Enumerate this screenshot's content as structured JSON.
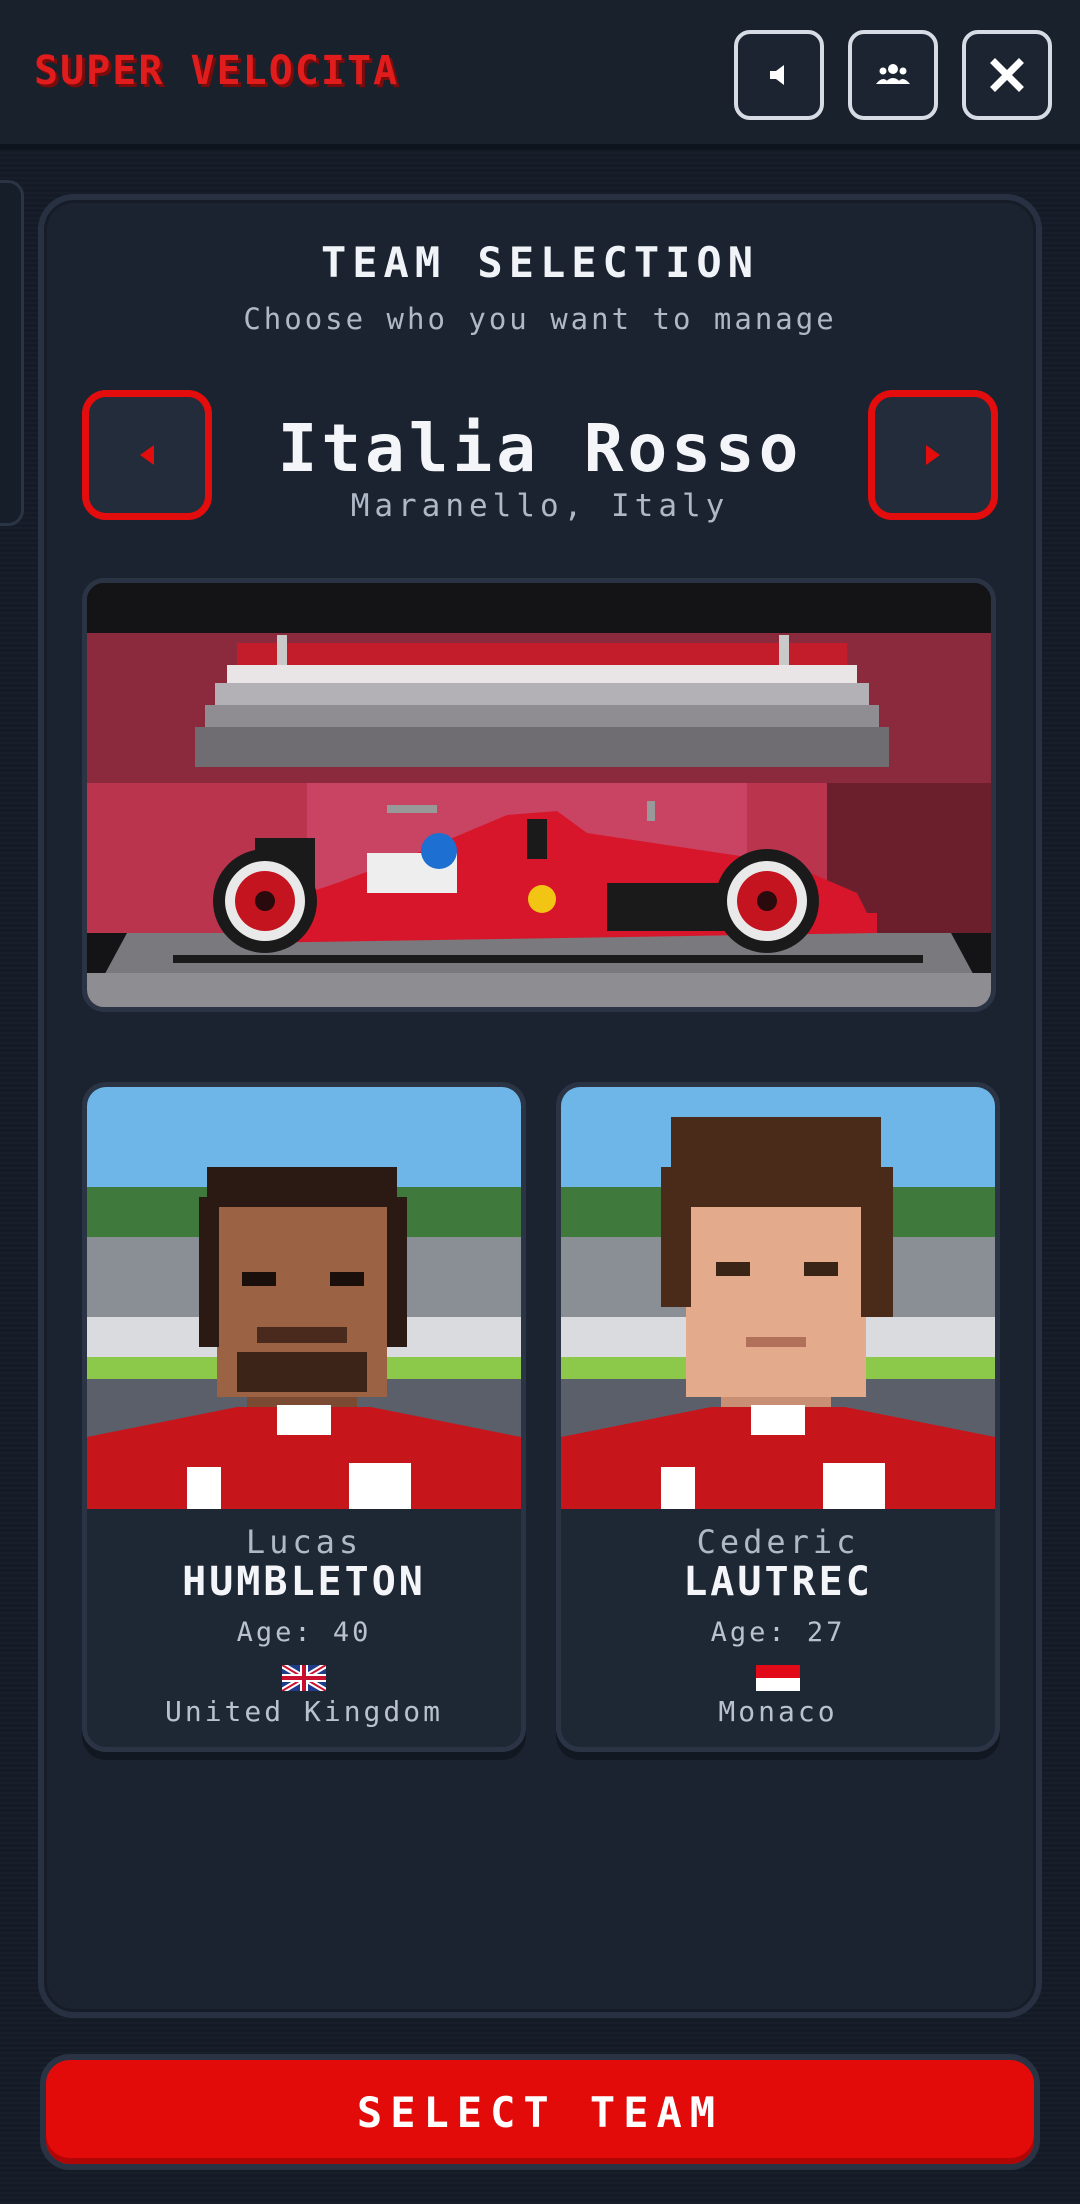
{
  "app": {
    "title": "SUPER VELOCITA"
  },
  "header": {
    "sound_icon": "speaker-icon",
    "team_icon": "people-icon",
    "close_icon": "close-icon"
  },
  "screen": {
    "title": "TEAM SELECTION",
    "subtitle": "Choose who you want to manage"
  },
  "team": {
    "name": "Italia Rosso",
    "location": "Maranello, Italy",
    "color": "#e30d0d"
  },
  "drivers": [
    {
      "first": "Lucas",
      "last": "HUMBLETON",
      "age": "Age: 40",
      "country": "United Kingdom",
      "flag": "uk-flag-icon"
    },
    {
      "first": "Cederic",
      "last": "LAUTREC",
      "age": "Age: 27",
      "country": "Monaco",
      "flag": "monaco-flag-icon"
    }
  ],
  "actions": {
    "select": "SELECT TEAM"
  }
}
